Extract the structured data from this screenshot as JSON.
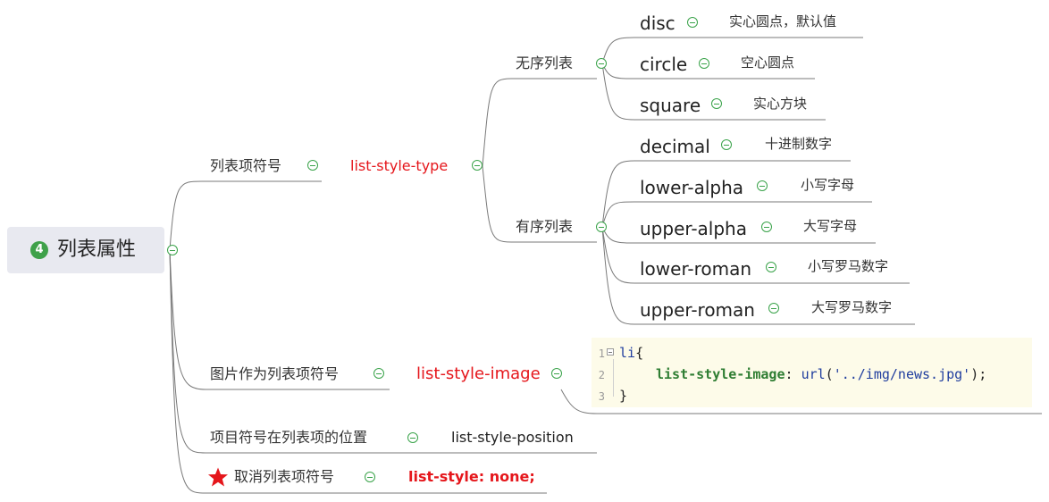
{
  "root": {
    "number": "4",
    "title": "列表属性"
  },
  "branches": {
    "list_type": {
      "label": "列表项符号",
      "property": "list-style-type",
      "unordered": {
        "label": "无序列表",
        "items": [
          {
            "value": "disc",
            "desc": "实心圆点，默认值"
          },
          {
            "value": "circle",
            "desc": "空心圆点"
          },
          {
            "value": "square",
            "desc": "实心方块"
          }
        ]
      },
      "ordered": {
        "label": "有序列表",
        "items": [
          {
            "value": "decimal",
            "desc": "十进制数字"
          },
          {
            "value": "lower-alpha",
            "desc": "小写字母"
          },
          {
            "value": "upper-alpha",
            "desc": "大写字母"
          },
          {
            "value": "lower-roman",
            "desc": "小写罗马数字"
          },
          {
            "value": "upper-roman",
            "desc": "大写罗马数字"
          }
        ]
      }
    },
    "list_image": {
      "label": "图片作为列表项符号",
      "property": "list-style-image",
      "code": {
        "line_numbers": [
          "1",
          "2",
          "3"
        ],
        "line1_selector": "li",
        "line1_brace": "{",
        "line2_property": "list-style-image",
        "line2_colon": ": ",
        "line2_func": "url",
        "line2_open": "(",
        "line2_string": "'../img/news.jpg'",
        "line2_close": ");",
        "line3_brace": "}"
      }
    },
    "list_position": {
      "label": "项目符号在列表项的位置",
      "property": "list-style-position"
    },
    "list_none": {
      "label": "取消列表项符号",
      "property": "list-style: none;",
      "marker_icon": "star-icon"
    }
  },
  "colors": {
    "accent_red": "#e5161b",
    "fold_green": "#3aa34a",
    "root_bg": "#e8e9f0",
    "code_bg": "#fdfbe9"
  }
}
